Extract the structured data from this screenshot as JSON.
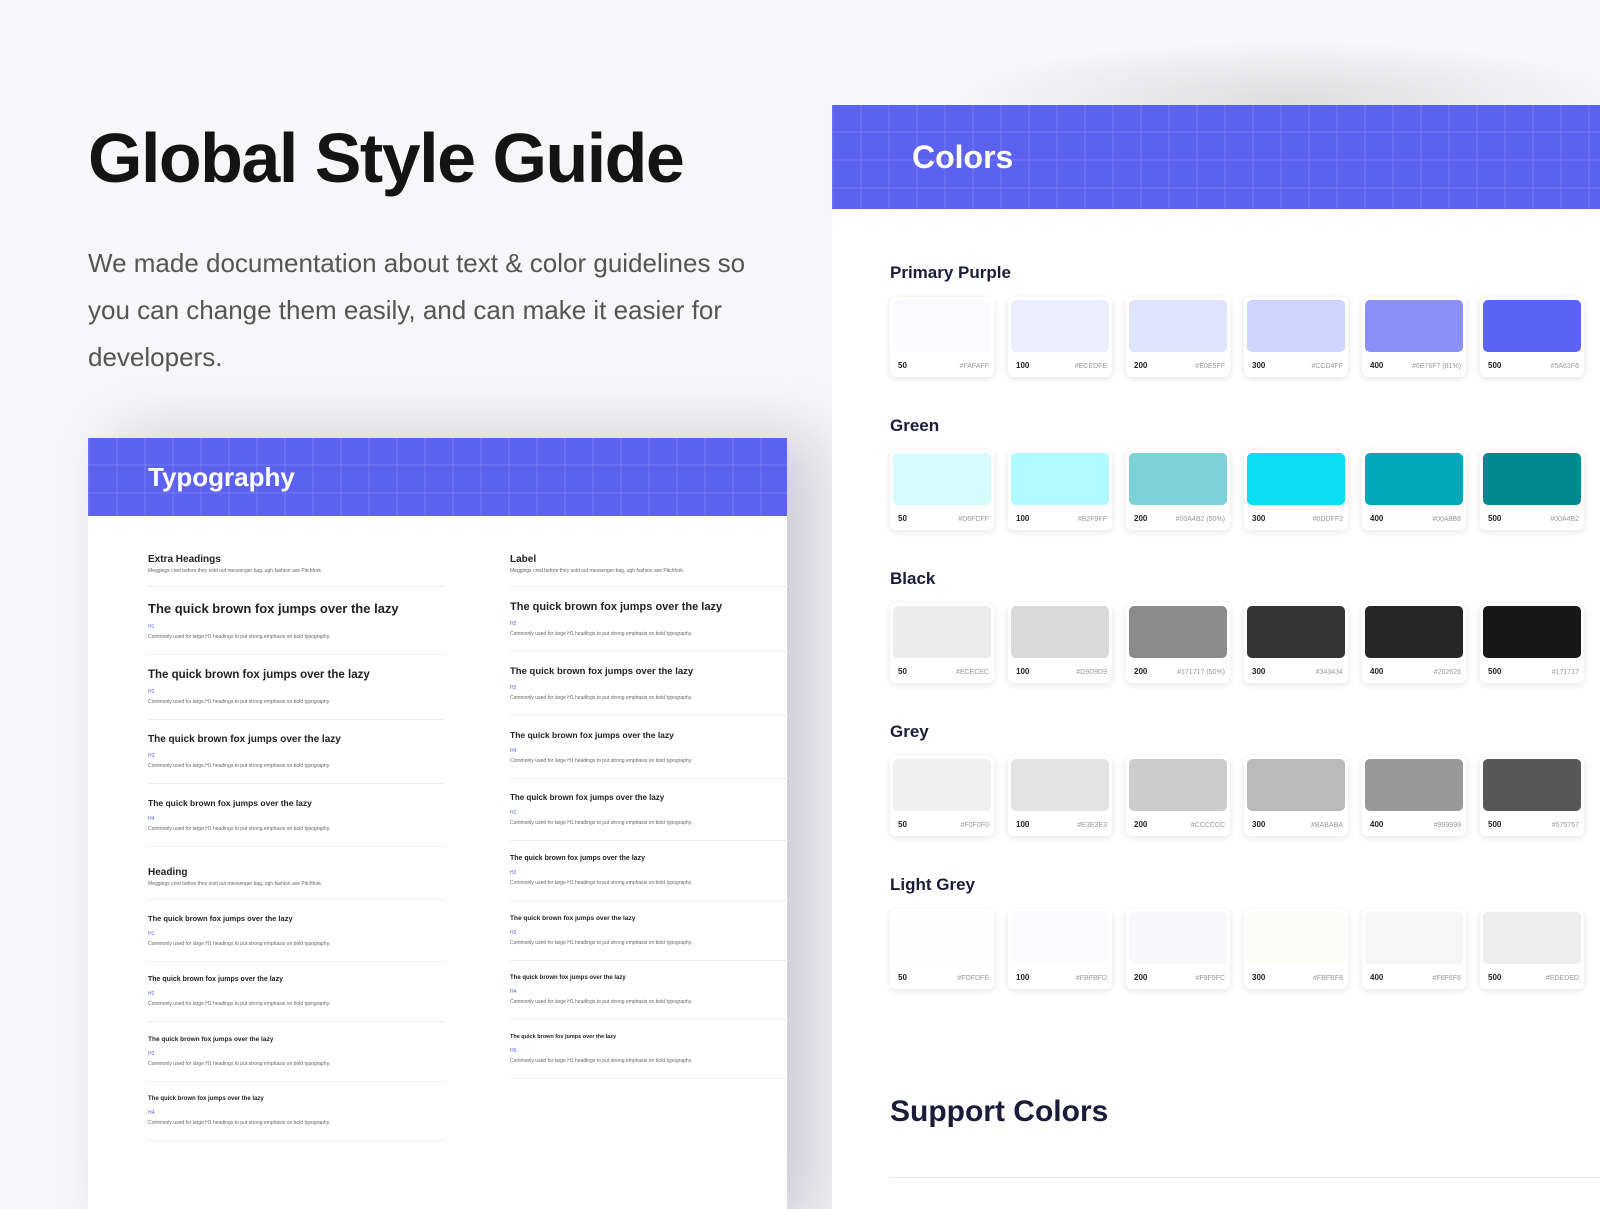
{
  "header": {
    "title": "Global Style Guide",
    "description": "We made documentation about text & color guidelines so you can change them easily, and can make it easier for developers."
  },
  "typography": {
    "banner": "Typography",
    "left": {
      "sections": [
        {
          "title": "Extra Headings",
          "subtitle": "Meggings cred before they sold out messenger bag, ugh fashion axe Pitchfork.",
          "items": [
            {
              "sample": "The quick brown fox jumps over the lazy",
              "tag": "H1",
              "note": "Commonly used for large H1 headings to put strong emphasis on bold typography.",
              "size": 13
            },
            {
              "sample": "The quick brown fox jumps over the lazy",
              "tag": "H2",
              "note": "Commonly used for large H1 headings to put strong emphasis on bold typography.",
              "size": 11.5
            },
            {
              "sample": "The quick brown fox jumps over the lazy",
              "tag": "H3",
              "note": "Commonly used for large H1 headings to put strong emphasis on bold typography.",
              "size": 10
            },
            {
              "sample": "The quick brown fox jumps over the lazy",
              "tag": "H4",
              "note": "Commonly used for large H1 headings to put strong emphasis on bold typography.",
              "size": 8.5
            }
          ]
        },
        {
          "title": "Heading",
          "subtitle": "Meggings cred before they sold out messenger bag, ugh fashion axe Pitchfork.",
          "items": [
            {
              "sample": "The quick brown fox jumps over the lazy",
              "tag": "H1",
              "note": "Commonly used for large H1 headings to put strong emphasis on bold typography.",
              "size": 7.5
            },
            {
              "sample": "The quick brown fox jumps over the lazy",
              "tag": "H2",
              "note": "Commonly used for large H1 headings to put strong emphasis on bold typography.",
              "size": 7
            },
            {
              "sample": "The quick brown fox jumps over the lazy",
              "tag": "H3",
              "note": "Commonly used for large H1 headings to put strong emphasis on bold typography.",
              "size": 6.5
            },
            {
              "sample": "The quick brown fox jumps over the lazy",
              "tag": "H4",
              "note": "Commonly used for large H1 headings to put strong emphasis on bold typography.",
              "size": 6
            }
          ]
        }
      ]
    },
    "right": {
      "sections": [
        {
          "title": "Label",
          "subtitle": "Meggings cred before they sold out messenger bag, ugh fashion axe Pitchfork.",
          "items": [
            {
              "sample": "The quick brown fox jumps over the lazy",
              "tag": "H2",
              "note": "Commonly used for large H1 headings to put strong emphasis on bold typography.",
              "size": 11
            },
            {
              "sample": "The quick brown fox jumps over the lazy",
              "tag": "H3",
              "note": "Commonly used for large H1 headings to put strong emphasis on bold typography.",
              "size": 9.5
            },
            {
              "sample": "The quick brown fox jumps over the lazy",
              "tag": "H4",
              "note": "Commonly used for large H1 headings to put strong emphasis on bold typography.",
              "size": 8.5
            },
            {
              "sample": "The quick brown fox jumps over the lazy",
              "tag": "H1",
              "note": "Commonly used for large H1 headings to put strong emphasis on bold typography.",
              "size": 8
            },
            {
              "sample": "The quick brown fox jumps over the lazy",
              "tag": "H2",
              "note": "Commonly used for large H1 headings to put strong emphasis on bold typography.",
              "size": 7
            },
            {
              "sample": "The quick brown fox jumps over the lazy",
              "tag": "H3",
              "note": "Commonly used for large H1 headings to put strong emphasis on bold typography.",
              "size": 6.5
            },
            {
              "sample": "The quick brown fox jumps over the lazy",
              "tag": "H4",
              "note": "Commonly used for large H1 headings to put strong emphasis on bold typography.",
              "size": 6
            },
            {
              "sample": "The quick brown fox jumps over the lazy",
              "tag": "H5",
              "note": "Commonly used for large H1 headings to put strong emphasis on bold typography.",
              "size": 5.5
            }
          ]
        }
      ]
    }
  },
  "colors": {
    "banner": "Colors",
    "groups": [
      {
        "title": "Primary Purple",
        "swatches": [
          {
            "level": "50",
            "hex": "#FAFAFF",
            "color": "#FAFAFF"
          },
          {
            "level": "100",
            "hex": "#ECEDFE",
            "color": "#ECEDFE"
          },
          {
            "level": "200",
            "hex": "#E0E5FF",
            "color": "#E0E5FF"
          },
          {
            "level": "300",
            "hex": "#CCD4FF",
            "color": "#CCD4FF"
          },
          {
            "level": "400",
            "hex": "#6E76F7 (81%)",
            "color": "#8A90F8"
          },
          {
            "level": "500",
            "hex": "#5A63F6",
            "color": "#5A63F6"
          }
        ]
      },
      {
        "title": "Green",
        "swatches": [
          {
            "level": "50",
            "hex": "#D6FCFF",
            "color": "#D6FCFF"
          },
          {
            "level": "100",
            "hex": "#B2F9FF",
            "color": "#B2F9FF"
          },
          {
            "level": "200",
            "hex": "#00A4B2 (50%)",
            "color": "#7FD1D8"
          },
          {
            "level": "300",
            "hex": "#0DDFF2",
            "color": "#0DDFF2"
          },
          {
            "level": "400",
            "hex": "#00A8B8",
            "color": "#00A8B8"
          },
          {
            "level": "500",
            "hex": "#00A4B2",
            "color": "#008891"
          }
        ]
      },
      {
        "title": "Black",
        "swatches": [
          {
            "level": "50",
            "hex": "#ECECEC",
            "color": "#ECECEC"
          },
          {
            "level": "100",
            "hex": "#D9D9D9",
            "color": "#D9D9D9"
          },
          {
            "level": "200",
            "hex": "#171717 (50%)",
            "color": "#8B8B8B"
          },
          {
            "level": "300",
            "hex": "#343434",
            "color": "#343434"
          },
          {
            "level": "400",
            "hex": "#262626",
            "color": "#262626"
          },
          {
            "level": "500",
            "hex": "#171717",
            "color": "#171717"
          }
        ]
      },
      {
        "title": "Grey",
        "swatches": [
          {
            "level": "50",
            "hex": "#F0F0F0",
            "color": "#F0F0F0"
          },
          {
            "level": "100",
            "hex": "#E3E3E3",
            "color": "#E3E3E3"
          },
          {
            "level": "200",
            "hex": "#CCCCCC",
            "color": "#CCCCCC"
          },
          {
            "level": "300",
            "hex": "#BABABA",
            "color": "#BABABA"
          },
          {
            "level": "400",
            "hex": "#999999",
            "color": "#999999"
          },
          {
            "level": "500",
            "hex": "#575757",
            "color": "#575757"
          }
        ]
      },
      {
        "title": "Light Grey",
        "swatches": [
          {
            "level": "50",
            "hex": "#FDFDFE",
            "color": "#FDFDFE"
          },
          {
            "level": "100",
            "hex": "#FBFBFD",
            "color": "#FBFBFD"
          },
          {
            "level": "200",
            "hex": "#F9F9FC",
            "color": "#F9F9FC"
          },
          {
            "level": "300",
            "hex": "#FBFBF8",
            "color": "#FBFBF8"
          },
          {
            "level": "400",
            "hex": "#F6F6F6",
            "color": "#F6F6F6"
          },
          {
            "level": "500",
            "hex": "#EDEDED",
            "color": "#EDEDED"
          }
        ]
      }
    ],
    "support_title": "Support Colors"
  }
}
